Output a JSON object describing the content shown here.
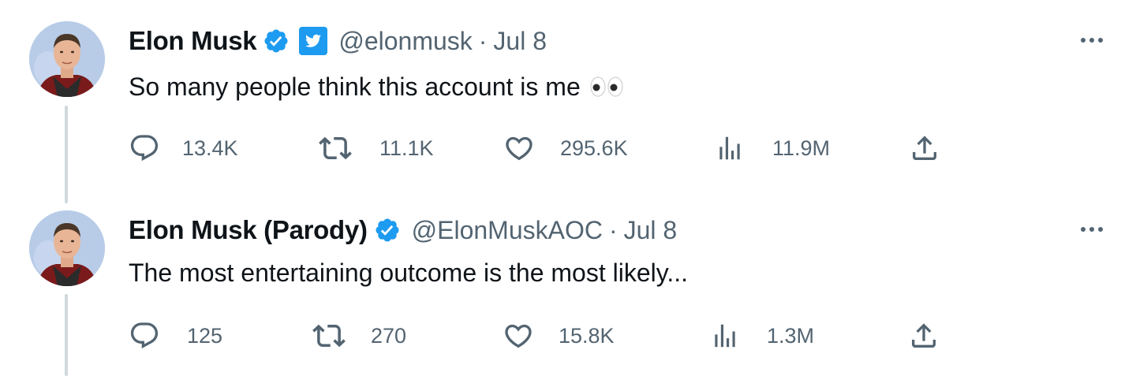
{
  "tweets": [
    {
      "name": "Elon Musk",
      "handle": "@elonmusk",
      "separator": "·",
      "date": "Jul 8",
      "verified": true,
      "twitter_badge": true,
      "text": "So many people think this account is me",
      "emoji": "eyes-emoji",
      "stats": {
        "replies": "13.4K",
        "retweets": "11.1K",
        "likes": "295.6K",
        "views": "11.9M"
      }
    },
    {
      "name": "Elon Musk (Parody)",
      "handle": "@ElonMuskAOC",
      "separator": "·",
      "date": "Jul 8",
      "verified": true,
      "twitter_badge": false,
      "text": "The most entertaining outcome is the most likely...",
      "stats": {
        "replies": "125",
        "retweets": "270",
        "likes": "15.8K",
        "views": "1.3M"
      }
    }
  ],
  "icons": [
    "verified-badge-icon",
    "twitter-bird-icon",
    "more-icon",
    "reply-icon",
    "retweet-icon",
    "like-icon",
    "views-icon",
    "share-icon"
  ],
  "colors": {
    "verified_blue": "#1d9bf0",
    "secondary_text": "#536471",
    "primary_text": "#0f1419",
    "thread_line": "#cfd9de"
  }
}
